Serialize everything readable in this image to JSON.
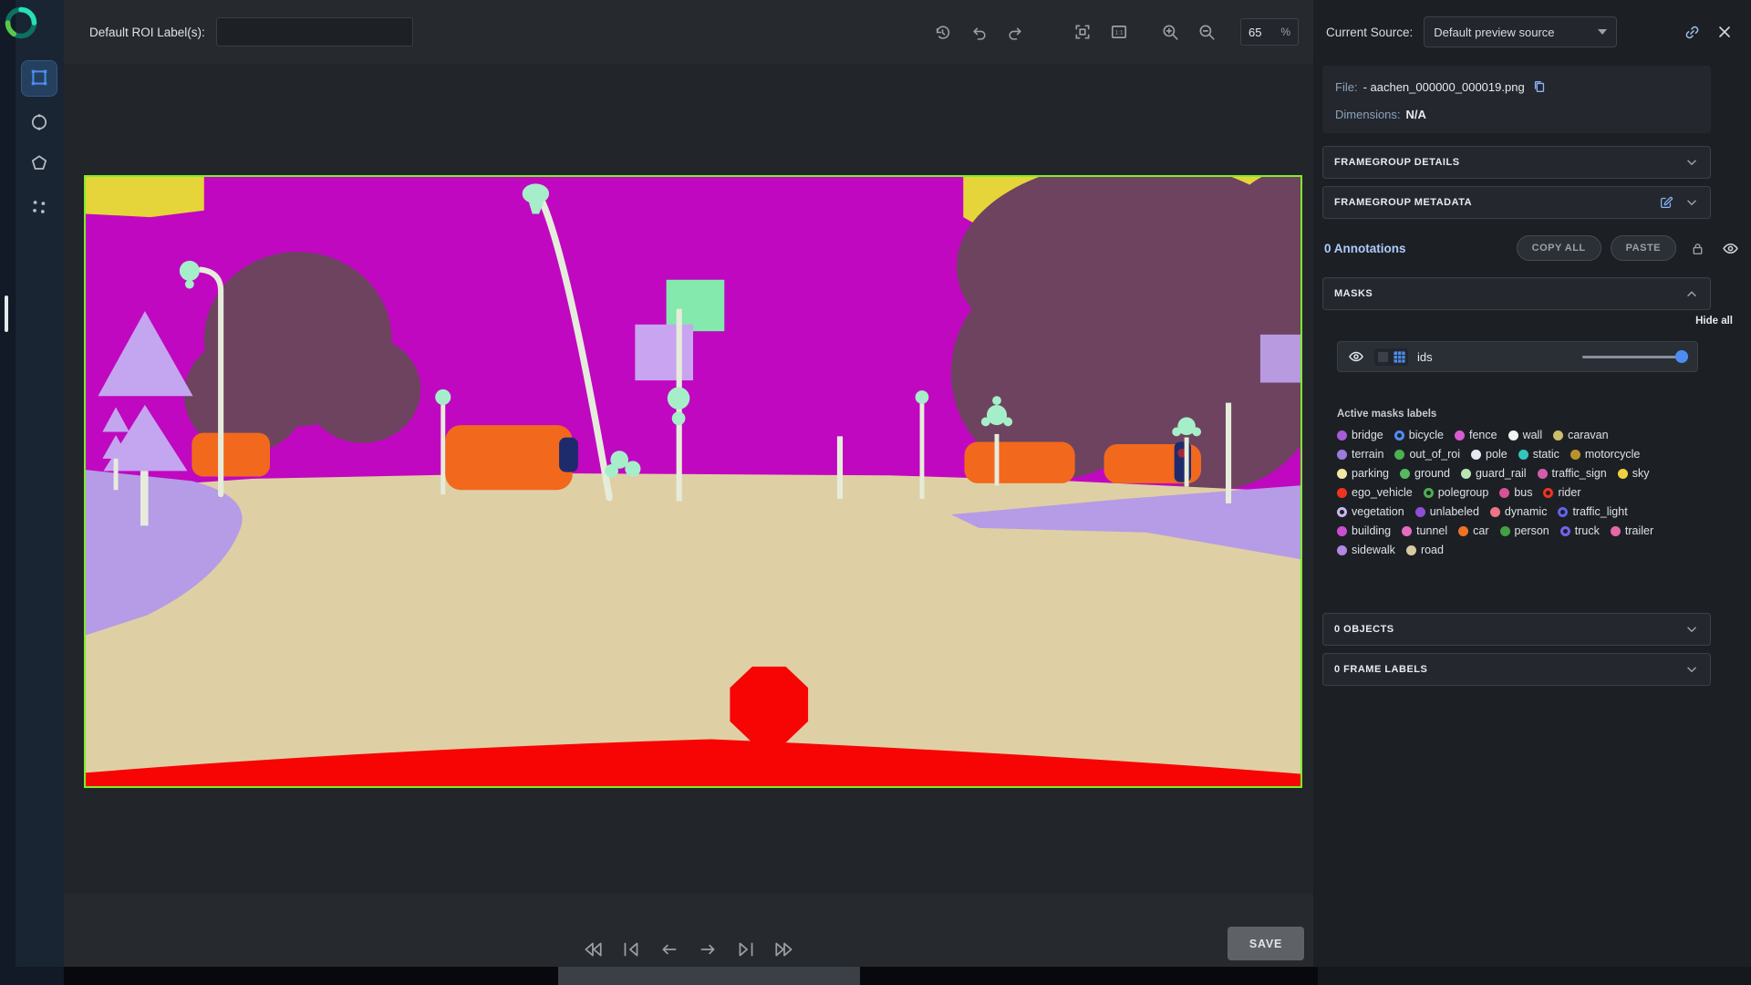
{
  "toolbar": {
    "roi_label": "Default ROI Label(s):",
    "roi_value": "",
    "zoom_value": "65",
    "zoom_unit": "%"
  },
  "source": {
    "label": "Current Source:",
    "selected": "Default preview source"
  },
  "file": {
    "file_label": "File:",
    "file_name": "- aachen_000000_000019.png",
    "dims_label": "Dimensions:",
    "dims_value": "N/A"
  },
  "sections": {
    "framegroup_details": "FRAMEGROUP DETAILS",
    "framegroup_metadata": "FRAMEGROUP METADATA",
    "objects": "0 OBJECTS",
    "frame_labels": "0 FRAME LABELS"
  },
  "annotations": {
    "count": "0 Annotations",
    "copy_all": "COPY ALL",
    "paste": "PASTE"
  },
  "masks": {
    "header": "MASKS",
    "hide_all": "Hide all",
    "layer_name": "ids",
    "active_title": "Active masks labels",
    "labels": [
      {
        "name": "bridge",
        "color": "#a55cd6",
        "hollow": false
      },
      {
        "name": "bicycle",
        "color": "#4d8df2",
        "hollow": true
      },
      {
        "name": "fence",
        "color": "#d65ccf",
        "hollow": false
      },
      {
        "name": "wall",
        "color": "#f2f2f2",
        "hollow": false
      },
      {
        "name": "caravan",
        "color": "#cdbf6a",
        "hollow": false
      },
      {
        "name": "terrain",
        "color": "#9b7bdc",
        "hollow": false
      },
      {
        "name": "out_of_roi",
        "color": "#4caf50",
        "hollow": false
      },
      {
        "name": "pole",
        "color": "#e8e8f2",
        "hollow": false
      },
      {
        "name": "static",
        "color": "#35c4bd",
        "hollow": false
      },
      {
        "name": "motorcycle",
        "color": "#b8922c",
        "hollow": false
      },
      {
        "name": "parking",
        "color": "#f2e9a2",
        "hollow": false
      },
      {
        "name": "ground",
        "color": "#56b85e",
        "hollow": false
      },
      {
        "name": "guard_rail",
        "color": "#b9e6b4",
        "hollow": false
      },
      {
        "name": "traffic_sign",
        "color": "#d65cab",
        "hollow": false
      },
      {
        "name": "sky",
        "color": "#f0d23e",
        "hollow": false
      },
      {
        "name": "ego_vehicle",
        "color": "#f23220",
        "hollow": false
      },
      {
        "name": "polegroup",
        "color": "#4caf50",
        "hollow": true
      },
      {
        "name": "bus",
        "color": "#d65298",
        "hollow": false
      },
      {
        "name": "rider",
        "color": "#f23220",
        "hollow": true
      },
      {
        "name": "vegetation",
        "color": "#cbb6f0",
        "hollow": true
      },
      {
        "name": "unlabeled",
        "color": "#8e4fd6",
        "hollow": false
      },
      {
        "name": "dynamic",
        "color": "#ef7486",
        "hollow": false
      },
      {
        "name": "traffic_light",
        "color": "#6161e8",
        "hollow": true
      },
      {
        "name": "building",
        "color": "#c94fd0",
        "hollow": false
      },
      {
        "name": "tunnel",
        "color": "#e66cc0",
        "hollow": false
      },
      {
        "name": "car",
        "color": "#f07224",
        "hollow": false
      },
      {
        "name": "person",
        "color": "#43a047",
        "hollow": false
      },
      {
        "name": "truck",
        "color": "#7263ea",
        "hollow": true
      },
      {
        "name": "trailer",
        "color": "#e668a6",
        "hollow": false
      },
      {
        "name": "sidewalk",
        "color": "#b287e2",
        "hollow": false
      },
      {
        "name": "road",
        "color": "#d9c9a3",
        "hollow": false
      }
    ]
  },
  "footer": {
    "save": "SAVE"
  },
  "scene": {
    "colors": {
      "building": "#c008c0",
      "road": "#ded0a4",
      "sidewalk": "#b69be6",
      "vegetation_dark": "#6d4360",
      "car": "#f2691d",
      "ego": "#f70505",
      "sign_yellow": "#e5d53a",
      "lamp_mint": "#a6eec9",
      "pole_white": "#e6ecdb",
      "person_navy": "#1d2b6d",
      "image_border": "#7bf02a"
    }
  }
}
